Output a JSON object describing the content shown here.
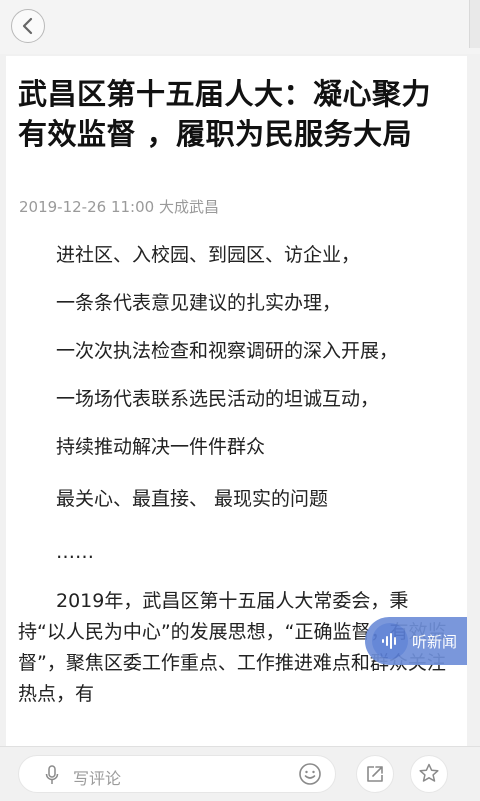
{
  "header": {
    "back_icon": "chevron-left-icon"
  },
  "article": {
    "title": "武昌区第十五届人大：凝心聚力有效监督 ，履职为民服务大局",
    "date": "2019-12-26 11:00",
    "source": "大成武昌",
    "paragraphs": [
      "进社区、入校园、到园区、访企业，",
      "一条条代表意见建议的扎实办理，",
      "一次次执法检查和视察调研的深入开展，",
      "一场场代表联系选民活动的坦诚互动，",
      "持续推动解决一件件群众",
      "最关心、最直接、 最现实的问题",
      "……",
      "2019年，武昌区第十五届人大常委会，秉持“以人民为中心”的发展思想，“正确监督，有效监督”，聚焦区委工作重点、工作推进难点和群众关注热点，有"
    ]
  },
  "listen": {
    "label": "听新闻",
    "icon": "audio-wave-icon",
    "color": "#6f8fd9"
  },
  "bottom_bar": {
    "comment_placeholder": "写评论",
    "mic_icon": "microphone-icon",
    "emoji_icon": "emoji-icon",
    "share_icon": "share-icon",
    "favorite_icon": "star-icon"
  }
}
